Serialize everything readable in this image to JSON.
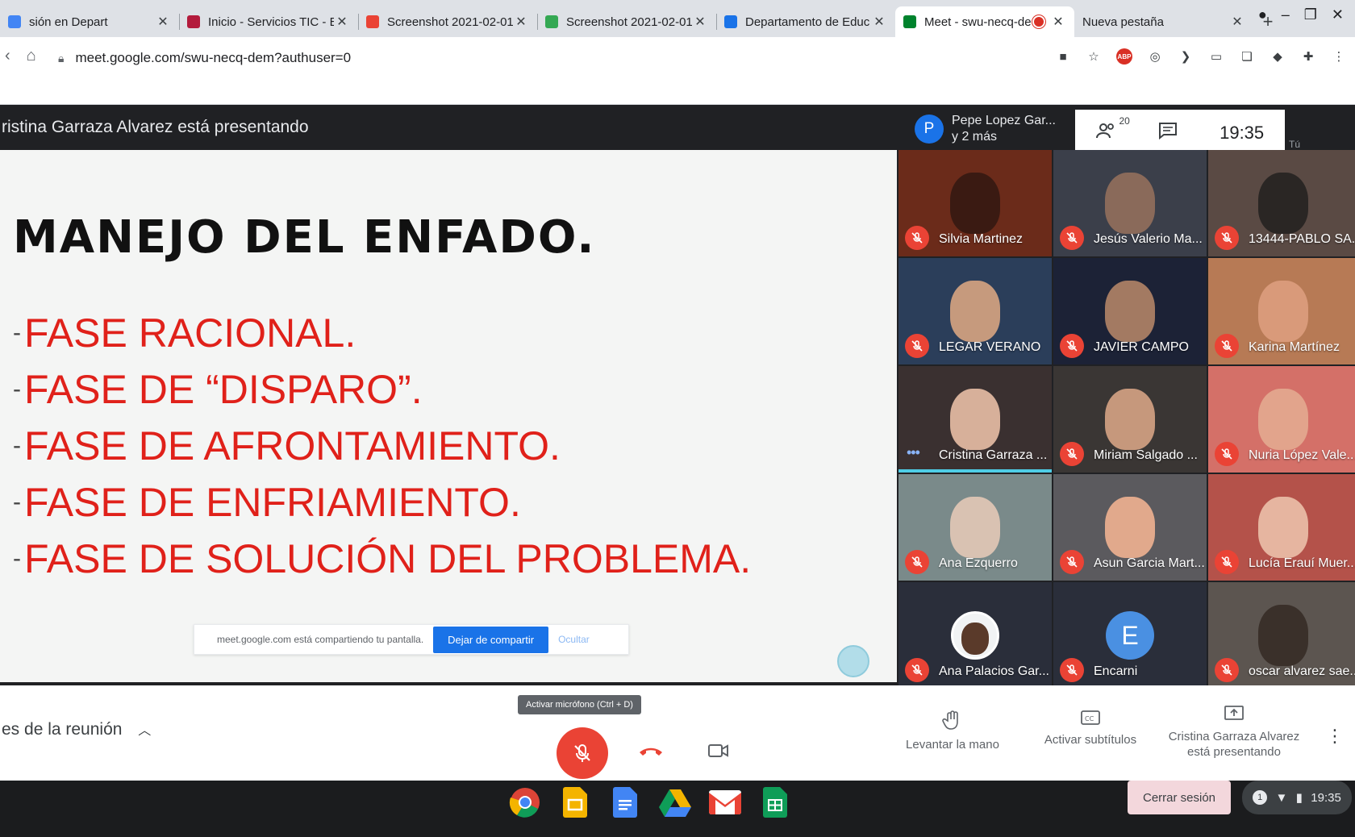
{
  "browser": {
    "tabs": [
      {
        "title": "sión en Depart",
        "favicon_color": "#4285f4"
      },
      {
        "title": "Inicio - Servicios TIC - E",
        "favicon_color": "#b31b3c"
      },
      {
        "title": "Screenshot 2021-02-01",
        "favicon_color": "#ea4335"
      },
      {
        "title": "Screenshot 2021-02-01",
        "favicon_color": "#34a853"
      },
      {
        "title": "Departamento de Educ",
        "favicon_color": "#1a73e8"
      },
      {
        "title": "Meet - swu-necq-de",
        "favicon_color": "#00832d"
      },
      {
        "title": "Nueva pestaña",
        "favicon_color": ""
      }
    ],
    "new_tab_symbol": "+",
    "url": "meet.google.com/swu-necq-dem?authuser=0",
    "extensions": [
      "camera-icon",
      "star-icon",
      "abp-icon",
      "compass-icon",
      "arrow-icon",
      "screen-icon",
      "copy-icon",
      "diamond-icon",
      "puzzle-icon",
      "menu-icon"
    ],
    "abp_label": "ABP"
  },
  "meet": {
    "presenting_text": "ristina Garraza Alvarez está presentando",
    "presenter": {
      "initial": "P",
      "name": "Pepe Lopez Gar...",
      "sub": "y 2 más"
    },
    "participants_count": "20",
    "clock": "19:35",
    "self_label": "Tú",
    "slide": {
      "title": "MANEJO DEL ENFADO.",
      "items": [
        "FASE RACIONAL.",
        "FASE DE “DISPARO”.",
        "FASE DE AFRONTAMIENTO.",
        "FASE DE ENFRIAMIENTO.",
        "FASE DE SOLUCIÓN DEL PROBLEMA."
      ],
      "dash": "-"
    },
    "share_bar": {
      "text": "meet.google.com está compartiendo tu pantalla.",
      "stop_label": "Dejar de compartir",
      "hide_label": "Ocultar"
    },
    "participants": [
      {
        "name": "Silvia Martinez",
        "muted": true,
        "bg": "#6b2b1a",
        "face": "#3a1a12"
      },
      {
        "name": "Jesús Valerio Ma...",
        "muted": true,
        "bg": "#3b3f4a",
        "face": "#8a6a5a"
      },
      {
        "name": "13444-PABLO SA...",
        "muted": true,
        "bg": "#5a4a44",
        "face": "#2a2624"
      },
      {
        "name": "LEGAR VERANO",
        "muted": true,
        "bg": "#2b3e5a",
        "face": "#c69a7d"
      },
      {
        "name": "JAVIER CAMPO",
        "muted": true,
        "bg": "#1c2236",
        "face": "#a37a62"
      },
      {
        "name": "Karina Martínez",
        "muted": true,
        "bg": "#b77a55",
        "face": "#d99a7a"
      },
      {
        "name": "Cristina Garraza ...",
        "muted": false,
        "speaking": true,
        "bg": "#3a3030",
        "face": "#d7b09a"
      },
      {
        "name": "Miriam Salgado ...",
        "muted": true,
        "bg": "#3a3634",
        "face": "#c6987c"
      },
      {
        "name": "Nuria López Vale...",
        "muted": true,
        "bg": "#d47068",
        "face": "#e2a48c"
      },
      {
        "name": "Ana Ezquerro",
        "muted": true,
        "bg": "#7a8a8a",
        "face": "#d9c2b2"
      },
      {
        "name": "Asun Garcia Mart...",
        "muted": true,
        "bg": "#5b5a5e",
        "face": "#e1a98c"
      },
      {
        "name": "Lucía Erauí Muer...",
        "muted": true,
        "bg": "#b4524a",
        "face": "#e6b5a0"
      },
      {
        "name": "Ana Palacios Gar...",
        "muted": true,
        "bg": "#2a2e3a",
        "avatar": "photo"
      },
      {
        "name": "Encarni",
        "muted": true,
        "bg": "#2a2e3a",
        "avatar": "E"
      },
      {
        "name": "oscar alvarez sae...",
        "muted": true,
        "bg": "#5c5550",
        "face": "#3a302a"
      }
    ],
    "bottom": {
      "details_label": "es de la reunión",
      "mic_tooltip": "Activar micrófono (Ctrl + D)",
      "raise_hand": "Levantar la mano",
      "captions": "Activar subtítulos",
      "presenting_line1": "Cristina Garraza Alvarez",
      "presenting_line2": "está presentando"
    }
  },
  "shelf": {
    "apps": [
      "chrome-icon",
      "slides-icon",
      "docs-icon",
      "drive-icon",
      "gmail-icon",
      "sheets-icon"
    ],
    "signout_label": "Cerrar sesión",
    "tray_badge": "1",
    "tray_time": "19:35"
  }
}
